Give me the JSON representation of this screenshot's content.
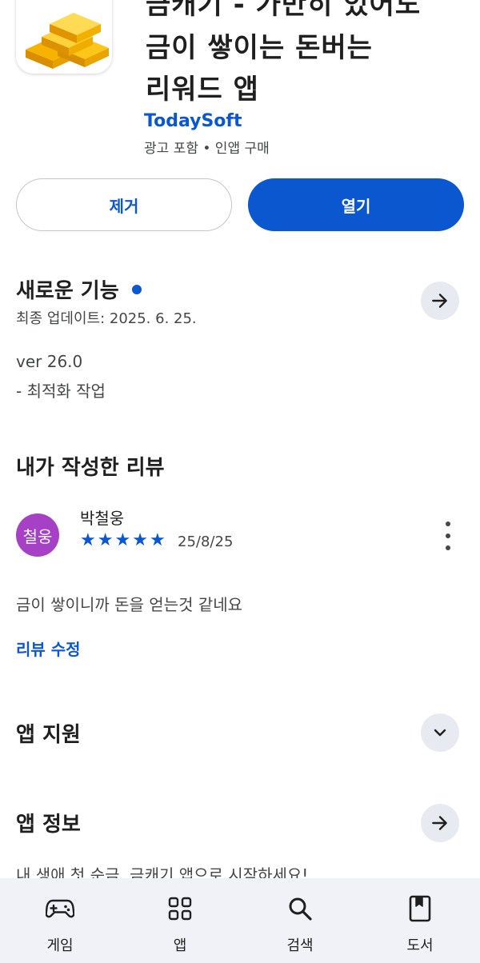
{
  "app": {
    "title_lines": [
      "금캐기 - 가만히 있어도",
      "금이 쌓이는 돈버는",
      "리워드 앱"
    ],
    "developer": "TodaySoft",
    "meta": "광고 포함 • 인앱 구매"
  },
  "buttons": {
    "uninstall": "제거",
    "open": "열기"
  },
  "whats_new": {
    "title": "새로운 기능",
    "updated": "최종 업데이트: 2025. 6. 25.",
    "version": "ver 26.0",
    "note": "- 최적화 작업"
  },
  "my_review": {
    "title": "내가 작성한 리뷰",
    "avatar_text": "철웅",
    "author": "박철웅",
    "rating": 5,
    "date": "25/8/25",
    "text": "금이 쌓이니까 돈을 얻는것 같네요",
    "edit": "리뷰 수정"
  },
  "app_support": {
    "title": "앱 지원"
  },
  "app_info": {
    "title": "앱 정보",
    "description": "내 생애 첫 순금, 금캐기 앱으로 시작하세요!"
  },
  "nav": [
    {
      "label": "게임",
      "icon": "gamepad-icon"
    },
    {
      "label": "앱",
      "icon": "apps-grid-icon"
    },
    {
      "label": "검색",
      "icon": "search-icon"
    },
    {
      "label": "도서",
      "icon": "book-icon"
    }
  ],
  "colors": {
    "accent": "#0b57d0",
    "avatar": "#a640c5",
    "nav_bg": "#f0f2f8"
  }
}
